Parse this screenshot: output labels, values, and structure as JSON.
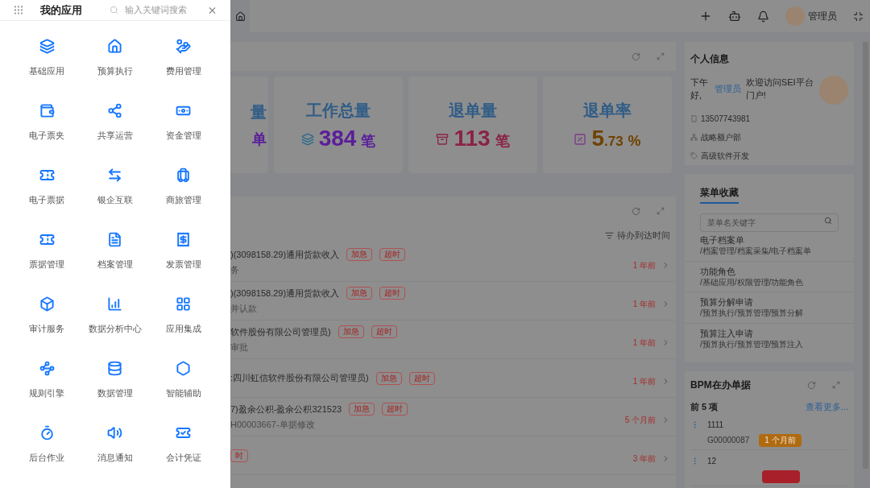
{
  "drawer": {
    "title": "我的应用",
    "search": {
      "placeholder": "输入关键词搜索"
    },
    "apps": [
      {
        "label": "基础应用"
      },
      {
        "label": "预算执行"
      },
      {
        "label": "费用管理"
      },
      {
        "label": "电子票夹"
      },
      {
        "label": "共享运营"
      },
      {
        "label": "资金管理"
      },
      {
        "label": "电子票据"
      },
      {
        "label": "银企互联"
      },
      {
        "label": "商旅管理"
      },
      {
        "label": "票据管理"
      },
      {
        "label": "档案管理"
      },
      {
        "label": "发票管理"
      },
      {
        "label": "审计服务"
      },
      {
        "label": "数据分析中心"
      },
      {
        "label": "应用集成"
      },
      {
        "label": "规则引擎"
      },
      {
        "label": "数据管理"
      },
      {
        "label": "智能辅助"
      },
      {
        "label": "后台作业"
      },
      {
        "label": "消息通知"
      },
      {
        "label": "会计凭证"
      }
    ]
  },
  "header": {
    "user": "管理员"
  },
  "stat_cards": [
    {
      "title": "量",
      "unit": "单",
      "color": "#5a1e9a"
    },
    {
      "title": "工作总量",
      "value": "384",
      "unit": "笔",
      "color": "#5a1e9a"
    },
    {
      "title": "退单量",
      "value": "113",
      "unit": "笔",
      "color": "#8a2346"
    },
    {
      "title": "退单率",
      "value": "5",
      "minor": ".73",
      "unit": "%",
      "color": "#6e4200"
    }
  ],
  "todo": {
    "sort_label": "待办到达时间",
    "rows": [
      {
        "title": ")(3098158.29)通用货款收入",
        "tags": [
          "加急",
          "超时"
        ],
        "subtitle": "务",
        "time": "1 年前"
      },
      {
        "title": ")(3098158.29)通用货款收入",
        "tags": [
          "加急",
          "超时"
        ],
        "subtitle": "并认款",
        "time": "1 年前"
      },
      {
        "title": "软件股份有限公司管理员)",
        "tags": [
          "加急",
          "超时"
        ],
        "subtitle": "审批",
        "time": "1 年前"
      },
      {
        "title": ":四川虹信软件股份有限公司管理员)",
        "tags": [
          "加急",
          "超时"
        ],
        "subtitle": "",
        "time": "1 年前"
      },
      {
        "title": "7)盈余公积-盈余公积321523",
        "tags": [
          "加急",
          "超时"
        ],
        "subtitle": "H00003667-单据修改",
        "time": "5 个月前"
      },
      {
        "title": "",
        "tags": [
          "时"
        ],
        "subtitle": "",
        "time": "3 年前"
      }
    ]
  },
  "profile": {
    "title": "个人信息",
    "greeting": "下午好,",
    "user_link": "管理员",
    "welcome": "欢迎访问SEI平台门户!",
    "phone": "13507743981",
    "department": "战略额户部",
    "position": "高级软件开发"
  },
  "favorites": {
    "tab": "菜单收藏",
    "search": {
      "placeholder": "菜单名关键字"
    },
    "items": [
      {
        "name": "电子档案单",
        "path": "/档案管理/档案采集/电子档案单"
      },
      {
        "name": "功能角色",
        "path": "/基础应用/权限管理/功能角色"
      },
      {
        "name": "预算分解申请",
        "path": "/预算执行/预算管理/预算分解"
      },
      {
        "name": "预算注入申请",
        "path": "/预算执行/预算管理/预算注入"
      }
    ]
  },
  "bpm": {
    "title": "BPM在办单据",
    "count_label": "前 5 项",
    "more": "查看更多...",
    "items": [
      {
        "title": "1111",
        "code": "G00000087",
        "badge": "1 个月前",
        "color": "#b06a10"
      },
      {
        "title": "12",
        "color": "#a8202a"
      }
    ]
  }
}
